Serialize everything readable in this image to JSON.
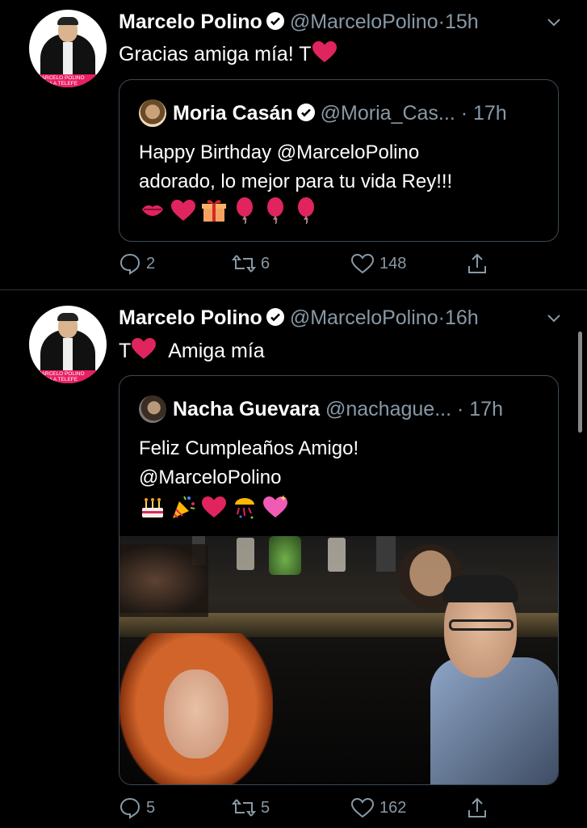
{
  "tweets": [
    {
      "author": "Marcelo Polino",
      "handle": "@MarceloPolino",
      "time": "15h",
      "text_prefix": "Gracias amiga mía! T",
      "avatar_band": "MARCELO POLINO SUMA A TELEFE",
      "quote": {
        "author": "Moria Casán",
        "handle": "@Moria_Cas...",
        "time": "17h",
        "line1": "Happy Birthday @MarceloPolino",
        "line2": "adorado, lo mejor para tu vida Rey!!!",
        "emojis": [
          "kiss-icon",
          "heart-icon",
          "gift-icon",
          "balloon-icon",
          "balloon-icon",
          "balloon-icon"
        ]
      },
      "replies": "2",
      "retweets": "6",
      "likes": "148"
    },
    {
      "author": "Marcelo Polino",
      "handle": "@MarceloPolino",
      "time": "16h",
      "text_prefix": "T",
      "text_suffix": "Amiga mía",
      "avatar_band": "MARCELO POLINO SUMA A TELEFE",
      "quote": {
        "author": "Nacha Guevara",
        "handle": "@nachague...",
        "time": "17h",
        "line1": "Feliz Cumpleaños Amigo!",
        "line2": "@MarceloPolino",
        "emojis": [
          "cake-icon",
          "party-popper-icon",
          "heart-icon",
          "confetti-icon",
          "sparkling-heart-icon"
        ]
      },
      "replies": "5",
      "retweets": "5",
      "likes": "162"
    }
  ],
  "colors": {
    "background": "#000000",
    "secondary_text": "#8899a6",
    "heart": "#e0245e",
    "border": "#3d4a55"
  },
  "separator": "·"
}
